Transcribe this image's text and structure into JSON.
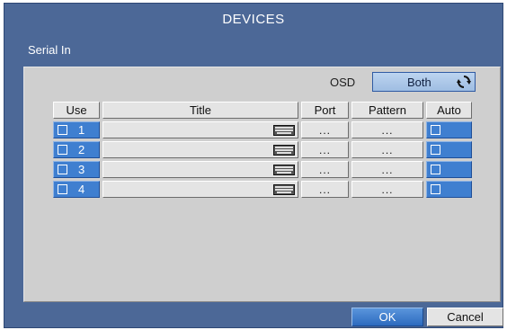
{
  "dialog": {
    "title": "DEVICES",
    "section": "Serial In"
  },
  "osd": {
    "label": "OSD",
    "value": "Both",
    "icon": "cycle-icon"
  },
  "table": {
    "headers": {
      "use": "Use",
      "title": "Title",
      "port": "Port",
      "pattern": "Pattern",
      "auto": "Auto"
    },
    "rows": [
      {
        "num": "1",
        "title": "",
        "port": "...",
        "pattern": "...",
        "use_checked": false,
        "auto_checked": false
      },
      {
        "num": "2",
        "title": "",
        "port": "...",
        "pattern": "...",
        "use_checked": false,
        "auto_checked": false
      },
      {
        "num": "3",
        "title": "",
        "port": "...",
        "pattern": "...",
        "use_checked": false,
        "auto_checked": false
      },
      {
        "num": "4",
        "title": "",
        "port": "...",
        "pattern": "...",
        "use_checked": false,
        "auto_checked": false
      }
    ]
  },
  "buttons": {
    "ok": "OK",
    "cancel": "Cancel"
  },
  "colors": {
    "frame": "#4c6897",
    "panel": "#cfcfcf",
    "accent": "#3f7fd0"
  }
}
